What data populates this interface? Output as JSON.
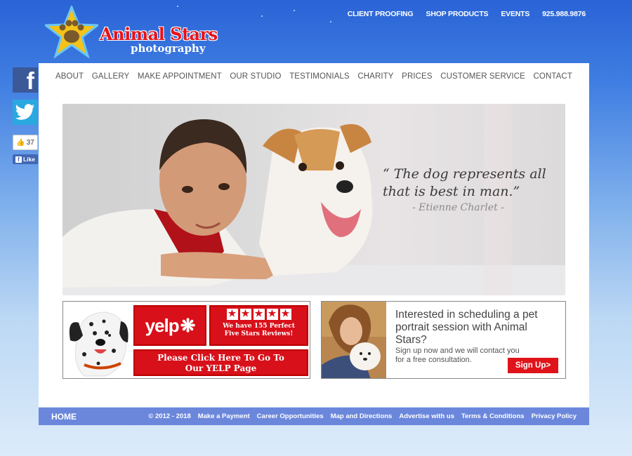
{
  "logo": {
    "title": "Animal Stars",
    "subtitle": "photography"
  },
  "top_links": [
    "CLIENT PROOFING",
    "SHOP PRODUCTS",
    "EVENTS",
    "925.988.9876"
  ],
  "nav": [
    "ABOUT",
    "GALLERY",
    "MAKE APPOINTMENT",
    "OUR STUDIO",
    "TESTIMONIALS",
    "CHARITY",
    "PRICES",
    "CUSTOMER SERVICE",
    "CONTACT"
  ],
  "social": {
    "like_count": "37",
    "like_label": "Like",
    "facebook_glyph": "f",
    "facebook_icon": "facebook-icon",
    "twitter_icon": "twitter-icon"
  },
  "hero": {
    "quote_line1": "“ The dog represents all",
    "quote_line2": "that is best in man.”",
    "author": "- Etienne Charlet -"
  },
  "yelp": {
    "logo_text": "yelp",
    "reviews_line1": "We have 155 Perfect",
    "reviews_line2": "Five Stars Reviews!",
    "cta_line1": "Please Click Here To Go To",
    "cta_line2": "Our YELP Page"
  },
  "signup": {
    "heading": "Interested in scheduling a pet portrait session with Animal Stars?",
    "body": "Sign up now and we will contact you for a free consultation.",
    "button": "Sign Up>"
  },
  "footer": {
    "home": "HOME",
    "copyright": "© 2012 - 2018",
    "links": [
      "Make a Payment",
      "Career  Opportunities",
      "Map and Directions",
      "Advertise with us",
      "Terms & Conditions",
      "Privacy Policy"
    ]
  },
  "colors": {
    "accent_red": "#e3131b",
    "nav_bar": "#6b87dc",
    "facebook": "#3b5998",
    "twitter": "#2aa8e0"
  }
}
